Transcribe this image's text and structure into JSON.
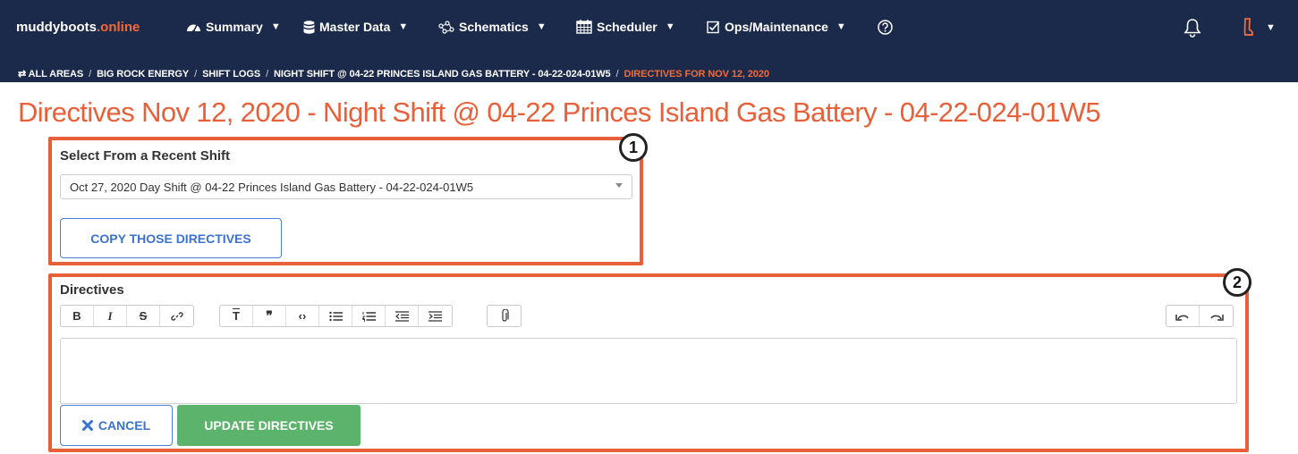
{
  "nav": {
    "brand_main": "muddyboots",
    "brand_accent": ".online",
    "items": [
      {
        "label": "Summary",
        "icon": "dashboard-icon"
      },
      {
        "label": "Master Data",
        "icon": "database-icon"
      },
      {
        "label": "Schematics",
        "icon": "schematic-icon"
      },
      {
        "label": "Scheduler",
        "icon": "calendar-icon"
      },
      {
        "label": "Ops/Maintenance",
        "icon": "checkbox-icon"
      }
    ],
    "help_icon": "help-icon",
    "notifications_icon": "bell-icon",
    "user_icon": "boot-icon"
  },
  "breadcrumb": {
    "items": [
      "⇄ ALL AREAS",
      "BIG ROCK ENERGY",
      "SHIFT LOGS",
      "NIGHT SHIFT @ 04-22 PRINCES ISLAND GAS BATTERY - 04-22-024-01W5"
    ],
    "current": "DIRECTIVES FOR NOV 12, 2020",
    "separator": "/"
  },
  "page": {
    "title": "Directives Nov 12, 2020 - Night Shift @ 04-22 Princes Island Gas Battery - 04-22-024-01W5"
  },
  "recent_shift": {
    "callout": "1",
    "label": "Select From a Recent Shift",
    "selected": "Oct 27, 2020 Day Shift @ 04-22 Princes Island Gas Battery - 04-22-024-01W5",
    "copy_button": "COPY THOSE DIRECTIVES"
  },
  "directives": {
    "callout": "2",
    "label": "Directives",
    "toolbar": [
      "bold",
      "italic",
      "strikethrough",
      "link",
      "heading",
      "quote",
      "code",
      "bullet-list",
      "numbered-list",
      "outdent",
      "indent",
      "attach",
      "undo",
      "redo"
    ],
    "toolbar_glyphs": {
      "bold": "B",
      "italic": "I",
      "strike": "S",
      "heading": "T",
      "quote": "❞",
      "code": "‹›"
    },
    "value": "",
    "cancel_button": "CANCEL",
    "update_button": "UPDATE DIRECTIVES"
  },
  "colors": {
    "nav_bg": "#1b2a4a",
    "accent": "#e8603a",
    "primary_blue": "#3b72cf",
    "success_green": "#5cb36b"
  }
}
